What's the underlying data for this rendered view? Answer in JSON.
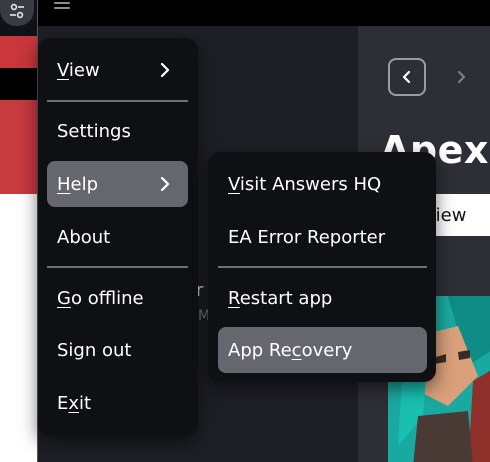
{
  "background": {
    "game_title": "Apex",
    "view_button": "view",
    "partial_text_1": "r",
    "partial_text_2": "M"
  },
  "menu": {
    "items": [
      {
        "id": "view",
        "pre": "",
        "ul": "V",
        "post": "iew",
        "has_submenu": true
      },
      {
        "id": "settings",
        "pre": "Settings",
        "ul": "",
        "post": "",
        "has_submenu": false
      },
      {
        "id": "help",
        "pre": "",
        "ul": "H",
        "post": "elp",
        "has_submenu": true
      },
      {
        "id": "about",
        "pre": "About",
        "ul": "",
        "post": "",
        "has_submenu": false
      },
      {
        "id": "go-offline",
        "pre": "",
        "ul": "G",
        "post": "o offline",
        "has_submenu": false
      },
      {
        "id": "sign-out",
        "pre": "Sign out",
        "ul": "",
        "post": "",
        "has_submenu": false
      },
      {
        "id": "exit",
        "pre": "E",
        "ul": "x",
        "post": "it",
        "has_submenu": false
      }
    ]
  },
  "submenu": {
    "items": [
      {
        "id": "visit-answers-hq",
        "pre": "",
        "ul": "V",
        "post": "isit Answers HQ"
      },
      {
        "id": "ea-error-reporter",
        "pre": "EA Error Reporter",
        "ul": "",
        "post": ""
      },
      {
        "id": "restart-app",
        "pre": "",
        "ul": "R",
        "post": "estart app"
      },
      {
        "id": "app-recovery",
        "pre": "App Re",
        "ul": "c",
        "post": "overy"
      }
    ]
  },
  "colors": {
    "menu_bg": "#0f1014",
    "highlight": "#66676e",
    "accent_red": "#c9363c"
  }
}
